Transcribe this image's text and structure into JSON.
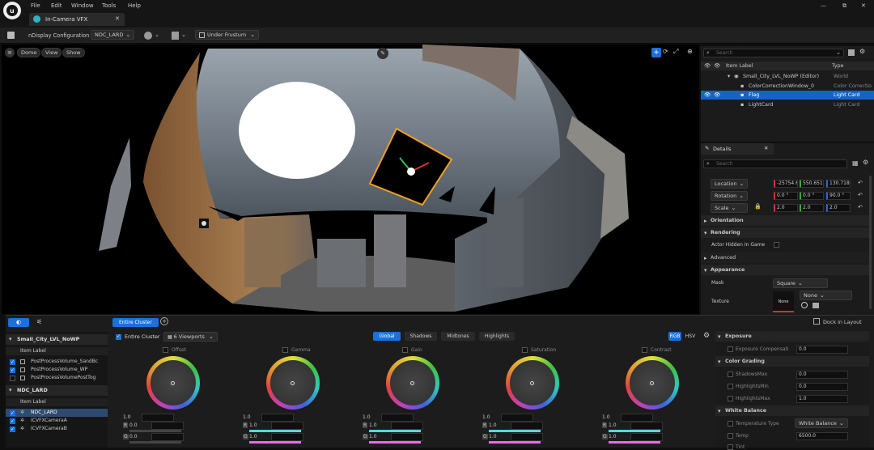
{
  "menu": [
    "File",
    "Edit",
    "Window",
    "Tools",
    "Help"
  ],
  "tab": {
    "title": "In-Camera VFX"
  },
  "window_controls": {
    "minimize": "—",
    "maximize": "⧉",
    "close": "✕"
  },
  "toolbar": {
    "config_label": "nDisplay Configuration",
    "config_value": "NDC_LARD",
    "frustum_value": "Under Frustum"
  },
  "viewport": {
    "dome": "Dome",
    "view": "View",
    "show": "Show"
  },
  "outliner": {
    "search_placeholder": "Search",
    "col_label": "Item Label",
    "col_type": "Type",
    "rows": [
      {
        "label": "Small_City_LVL_NoWP (Editor)",
        "type": "World"
      },
      {
        "label": "ColorCorrectionWindow_0",
        "type": "Color Correctio"
      },
      {
        "label": "Flag",
        "type": "Light Card"
      },
      {
        "label": "LightCard",
        "type": "Light Card"
      }
    ]
  },
  "details": {
    "tab": "Details",
    "search_placeholder": "Search",
    "location_label": "Location",
    "location": [
      "-25754.6",
      "550.651(",
      "130.718"
    ],
    "rotation_label": "Rotation",
    "rotation": [
      "0.0 °",
      "0.0 °",
      "90.0 °"
    ],
    "scale_label": "Scale",
    "scale": [
      "2.0",
      "2.0",
      "2.0"
    ],
    "sections": [
      "Orientation",
      "Rendering",
      "Advanced",
      "Appearance"
    ],
    "actor_hidden": "Actor Hidden In Game",
    "mask_label": "Mask",
    "mask_value": "Square",
    "texture_label": "Texture",
    "texture_value": "None",
    "texture_thumb": "None"
  },
  "bottom": {
    "entire_cluster_tab": "Entire Cluster",
    "dock": "Dock in Layout",
    "entire_cluster_check": "Entire Cluster",
    "viewports": "6 Viewports",
    "tabs": [
      "Global",
      "Shadows",
      "Midtones",
      "Highlights"
    ],
    "rgb": "RGB",
    "hsv": "HSV",
    "wheels": [
      {
        "name": "Offset",
        "v": "1.0",
        "r": "0.0",
        "g": "0.0"
      },
      {
        "name": "Gamma",
        "v": "1.0",
        "r": "1.0",
        "g": "1.0"
      },
      {
        "name": "Gain",
        "v": "1.0",
        "r": "1.0",
        "g": "1.0"
      },
      {
        "name": "Saturation",
        "v": "1.0",
        "r": "1.0",
        "g": "1.0"
      },
      {
        "name": "Contrast",
        "v": "1.0",
        "r": "1.0",
        "g": "1.0"
      }
    ],
    "channel_r": "R",
    "channel_g": "G"
  },
  "left_list": {
    "group1": "Small_City_LVL_NoWP",
    "item_label1": "Item Label",
    "items1": [
      "PostProcessVolume_SandBc",
      "PostProcessVolume_WP",
      "PostProcessVolumePostTog"
    ],
    "group2": "NDC_LARD",
    "item_label2": "Item Label",
    "items2": [
      "NDC_LARD",
      "ICVFXCameraA",
      "ICVFXCameraB"
    ]
  },
  "right_panel": {
    "exposure": "Exposure",
    "exposure_comp": "Exposure Compensati",
    "exposure_comp_v": "0.0",
    "color_grading": "Color Grading",
    "shadows_max": "ShadowsMax",
    "shadows_max_v": "0.0",
    "highlights_min": "HighlightsMin",
    "highlights_min_v": "0.0",
    "highlights_max": "HighlightsMax",
    "highlights_max_v": "1.0",
    "white_balance": "White Balance",
    "temp_type": "Temperature Type",
    "temp_type_v": "White Balance",
    "temp": "Temp",
    "temp_v": "6500.0",
    "tint": "Tint"
  },
  "colors": {
    "accent": "#1e6fd9",
    "selected_row": "#1464c8",
    "gizmo": "#f0a020"
  }
}
